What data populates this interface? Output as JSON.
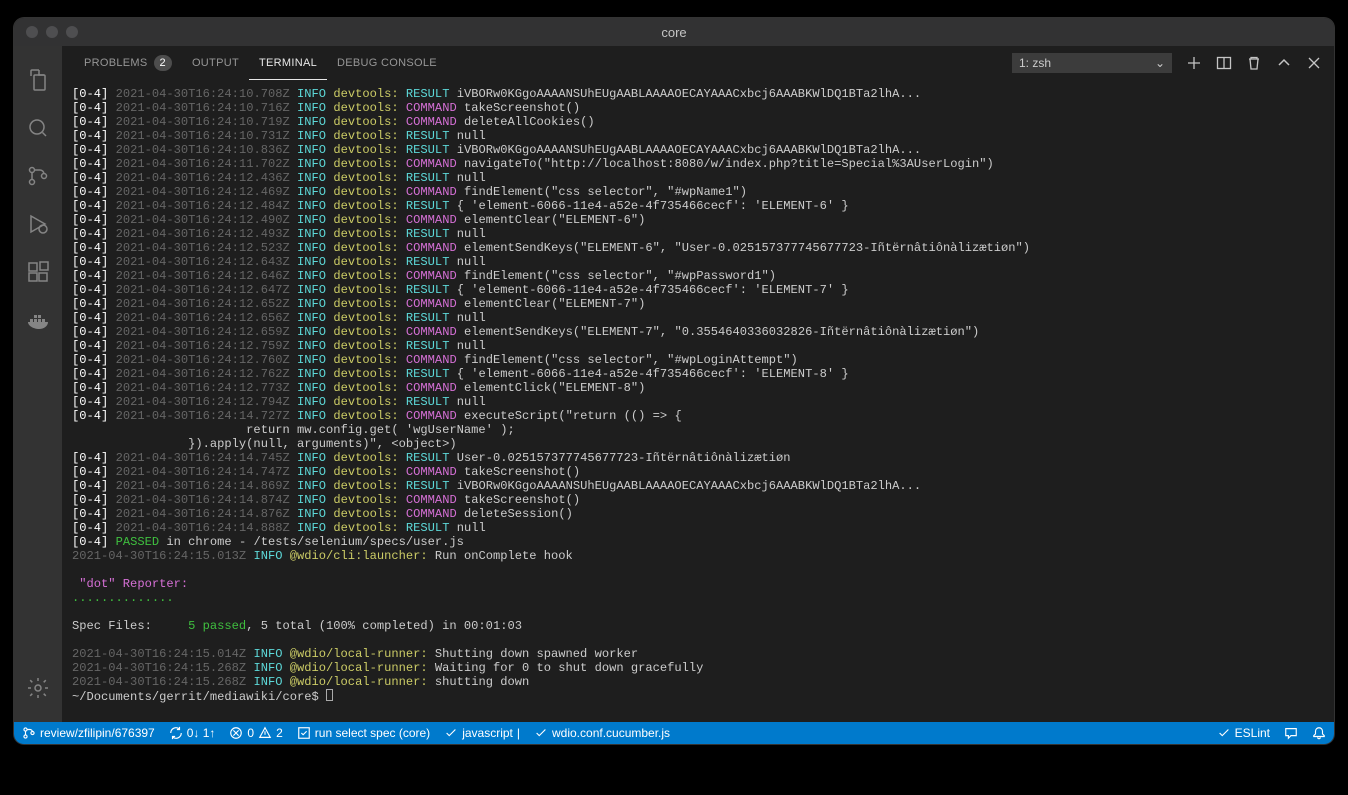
{
  "window": {
    "title": "core"
  },
  "tabs": {
    "problems": {
      "label": "PROBLEMS",
      "badge": "2"
    },
    "output": {
      "label": "OUTPUT"
    },
    "terminal": {
      "label": "TERMINAL"
    },
    "debug": {
      "label": "DEBUG CONSOLE"
    }
  },
  "shell": {
    "selected": "1: zsh"
  },
  "terminal_lines": [
    {
      "prefix": "[0-4]",
      "ts": "2021-04-30T16:24:10.708Z",
      "level": "INFO",
      "src": "devtools:",
      "kind": "RESULT",
      "rest": "iVBORw0KGgoAAAANSUhEUgAABLAAAAOECAYAAACxbcj6AAABKWlDQ1BTa2lhA..."
    },
    {
      "prefix": "[0-4]",
      "ts": "2021-04-30T16:24:10.716Z",
      "level": "INFO",
      "src": "devtools:",
      "kind": "COMMAND",
      "rest": "takeScreenshot()"
    },
    {
      "prefix": "[0-4]",
      "ts": "2021-04-30T16:24:10.719Z",
      "level": "INFO",
      "src": "devtools:",
      "kind": "COMMAND",
      "rest": "deleteAllCookies()"
    },
    {
      "prefix": "[0-4]",
      "ts": "2021-04-30T16:24:10.731Z",
      "level": "INFO",
      "src": "devtools:",
      "kind": "RESULT",
      "rest": "null"
    },
    {
      "prefix": "[0-4]",
      "ts": "2021-04-30T16:24:10.836Z",
      "level": "INFO",
      "src": "devtools:",
      "kind": "RESULT",
      "rest": "iVBORw0KGgoAAAANSUhEUgAABLAAAAOECAYAAACxbcj6AAABKWlDQ1BTa2lhA..."
    },
    {
      "prefix": "[0-4]",
      "ts": "2021-04-30T16:24:11.702Z",
      "level": "INFO",
      "src": "devtools:",
      "kind": "COMMAND",
      "rest": "navigateTo(\"http://localhost:8080/w/index.php?title=Special%3AUserLogin\")"
    },
    {
      "prefix": "[0-4]",
      "ts": "2021-04-30T16:24:12.436Z",
      "level": "INFO",
      "src": "devtools:",
      "kind": "RESULT",
      "rest": "null"
    },
    {
      "prefix": "[0-4]",
      "ts": "2021-04-30T16:24:12.469Z",
      "level": "INFO",
      "src": "devtools:",
      "kind": "COMMAND",
      "rest": "findElement(\"css selector\", \"#wpName1\")"
    },
    {
      "prefix": "[0-4]",
      "ts": "2021-04-30T16:24:12.484Z",
      "level": "INFO",
      "src": "devtools:",
      "kind": "RESULT",
      "rest": "{ 'element-6066-11e4-a52e-4f735466cecf': 'ELEMENT-6' }"
    },
    {
      "prefix": "[0-4]",
      "ts": "2021-04-30T16:24:12.490Z",
      "level": "INFO",
      "src": "devtools:",
      "kind": "COMMAND",
      "rest": "elementClear(\"ELEMENT-6\")"
    },
    {
      "prefix": "[0-4]",
      "ts": "2021-04-30T16:24:12.493Z",
      "level": "INFO",
      "src": "devtools:",
      "kind": "RESULT",
      "rest": "null"
    },
    {
      "prefix": "[0-4]",
      "ts": "2021-04-30T16:24:12.523Z",
      "level": "INFO",
      "src": "devtools:",
      "kind": "COMMAND",
      "rest": "elementSendKeys(\"ELEMENT-6\", \"User-0.025157377745677723-Iñtërnâtiônàlizætiøn\")"
    },
    {
      "prefix": "[0-4]",
      "ts": "2021-04-30T16:24:12.643Z",
      "level": "INFO",
      "src": "devtools:",
      "kind": "RESULT",
      "rest": "null"
    },
    {
      "prefix": "[0-4]",
      "ts": "2021-04-30T16:24:12.646Z",
      "level": "INFO",
      "src": "devtools:",
      "kind": "COMMAND",
      "rest": "findElement(\"css selector\", \"#wpPassword1\")"
    },
    {
      "prefix": "[0-4]",
      "ts": "2021-04-30T16:24:12.647Z",
      "level": "INFO",
      "src": "devtools:",
      "kind": "RESULT",
      "rest": "{ 'element-6066-11e4-a52e-4f735466cecf': 'ELEMENT-7' }"
    },
    {
      "prefix": "[0-4]",
      "ts": "2021-04-30T16:24:12.652Z",
      "level": "INFO",
      "src": "devtools:",
      "kind": "COMMAND",
      "rest": "elementClear(\"ELEMENT-7\")"
    },
    {
      "prefix": "[0-4]",
      "ts": "2021-04-30T16:24:12.656Z",
      "level": "INFO",
      "src": "devtools:",
      "kind": "RESULT",
      "rest": "null"
    },
    {
      "prefix": "[0-4]",
      "ts": "2021-04-30T16:24:12.659Z",
      "level": "INFO",
      "src": "devtools:",
      "kind": "COMMAND",
      "rest": "elementSendKeys(\"ELEMENT-7\", \"0.3554640336032826-Iñtërnâtiônàlizætiøn\")"
    },
    {
      "prefix": "[0-4]",
      "ts": "2021-04-30T16:24:12.759Z",
      "level": "INFO",
      "src": "devtools:",
      "kind": "RESULT",
      "rest": "null"
    },
    {
      "prefix": "[0-4]",
      "ts": "2021-04-30T16:24:12.760Z",
      "level": "INFO",
      "src": "devtools:",
      "kind": "COMMAND",
      "rest": "findElement(\"css selector\", \"#wpLoginAttempt\")"
    },
    {
      "prefix": "[0-4]",
      "ts": "2021-04-30T16:24:12.762Z",
      "level": "INFO",
      "src": "devtools:",
      "kind": "RESULT",
      "rest": "{ 'element-6066-11e4-a52e-4f735466cecf': 'ELEMENT-8' }"
    },
    {
      "prefix": "[0-4]",
      "ts": "2021-04-30T16:24:12.773Z",
      "level": "INFO",
      "src": "devtools:",
      "kind": "COMMAND",
      "rest": "elementClick(\"ELEMENT-8\")"
    },
    {
      "prefix": "[0-4]",
      "ts": "2021-04-30T16:24:12.794Z",
      "level": "INFO",
      "src": "devtools:",
      "kind": "RESULT",
      "rest": "null"
    },
    {
      "prefix": "[0-4]",
      "ts": "2021-04-30T16:24:14.727Z",
      "level": "INFO",
      "src": "devtools:",
      "kind": "COMMAND",
      "rest": "executeScript(\"return (() => {"
    },
    {
      "raw": "                        return mw.config.get( 'wgUserName' );"
    },
    {
      "raw": "                }).apply(null, arguments)\", <object>)"
    },
    {
      "prefix": "[0-4]",
      "ts": "2021-04-30T16:24:14.745Z",
      "level": "INFO",
      "src": "devtools:",
      "kind": "RESULT",
      "rest": "User-0.025157377745677723-Iñtërnâtiônàlizætiøn"
    },
    {
      "prefix": "[0-4]",
      "ts": "2021-04-30T16:24:14.747Z",
      "level": "INFO",
      "src": "devtools:",
      "kind": "COMMAND",
      "rest": "takeScreenshot()"
    },
    {
      "prefix": "[0-4]",
      "ts": "2021-04-30T16:24:14.869Z",
      "level": "INFO",
      "src": "devtools:",
      "kind": "RESULT",
      "rest": "iVBORw0KGgoAAAANSUhEUgAABLAAAAOECAYAAACxbcj6AAABKWlDQ1BTa2lhA..."
    },
    {
      "prefix": "[0-4]",
      "ts": "2021-04-30T16:24:14.874Z",
      "level": "INFO",
      "src": "devtools:",
      "kind": "COMMAND",
      "rest": "takeScreenshot()"
    },
    {
      "prefix": "[0-4]",
      "ts": "2021-04-30T16:24:14.876Z",
      "level": "INFO",
      "src": "devtools:",
      "kind": "COMMAND",
      "rest": "deleteSession()"
    },
    {
      "prefix": "[0-4]",
      "ts": "2021-04-30T16:24:14.888Z",
      "level": "INFO",
      "src": "devtools:",
      "kind": "RESULT",
      "rest": "null"
    }
  ],
  "passed_line": {
    "prefix": "[0-4]",
    "status": "PASSED",
    "rest": "in chrome - /tests/selenium/specs/user.js"
  },
  "launcher_line": {
    "ts": "2021-04-30T16:24:15.013Z",
    "level": "INFO",
    "src": "@wdio/cli:launcher:",
    "rest": "Run onComplete hook"
  },
  "reporter_label": " \"dot\" Reporter:",
  "dots": "..............",
  "spec_label": "Spec Files:\t",
  "spec_passed": "5 passed",
  "spec_rest": ", 5 total (100% completed) in 00:01:03",
  "shutdown_lines": [
    {
      "ts": "2021-04-30T16:24:15.014Z",
      "level": "INFO",
      "src": "@wdio/local-runner:",
      "rest": "Shutting down spawned worker"
    },
    {
      "ts": "2021-04-30T16:24:15.268Z",
      "level": "INFO",
      "src": "@wdio/local-runner:",
      "rest": "Waiting for 0 to shut down gracefully"
    },
    {
      "ts": "2021-04-30T16:24:15.268Z",
      "level": "INFO",
      "src": "@wdio/local-runner:",
      "rest": "shutting down"
    }
  ],
  "prompt": "~/Documents/gerrit/mediawiki/core$ ",
  "statusbar": {
    "branch": "review/zfilipin/676397",
    "sync": "0↓ 1↑",
    "errors": "0",
    "warnings": "2",
    "task": "run select spec (core)",
    "lang": "javascript",
    "config": "wdio.conf.cucumber.js",
    "eslint": "ESLint"
  }
}
